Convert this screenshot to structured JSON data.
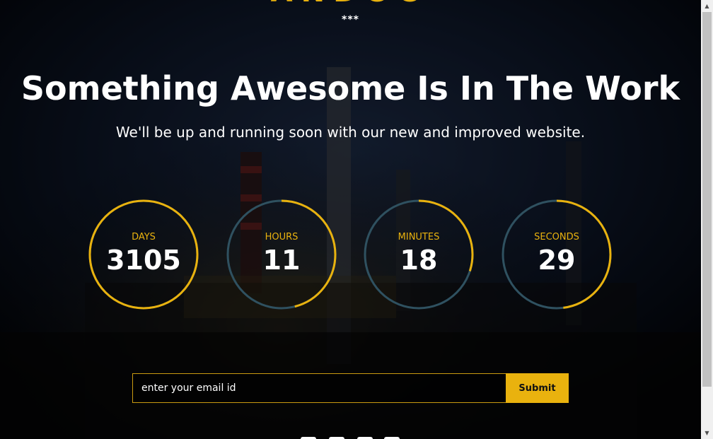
{
  "brand": {
    "logo_text": "ANDOO",
    "divider": "***"
  },
  "hero": {
    "title": "Something Awesome Is In The Work",
    "subtitle": "We'll be up and running soon with our new and improved website."
  },
  "countdown": [
    {
      "label": "DAYS",
      "value": "3105",
      "progress": 1.0
    },
    {
      "label": "HOURS",
      "value": "11",
      "progress": 0.46
    },
    {
      "label": "MINUTES",
      "value": "18",
      "progress": 0.3
    },
    {
      "label": "SECONDS",
      "value": "29",
      "progress": 0.48
    }
  ],
  "subscribe": {
    "placeholder": "enter your email id",
    "button_label": "Submit"
  },
  "colors": {
    "accent": "#e9b20e",
    "ring_track": "#2f5160",
    "text": "#ffffff"
  },
  "social_icons": [
    "social-icon-1",
    "social-icon-2",
    "social-icon-3",
    "social-icon-4"
  ]
}
